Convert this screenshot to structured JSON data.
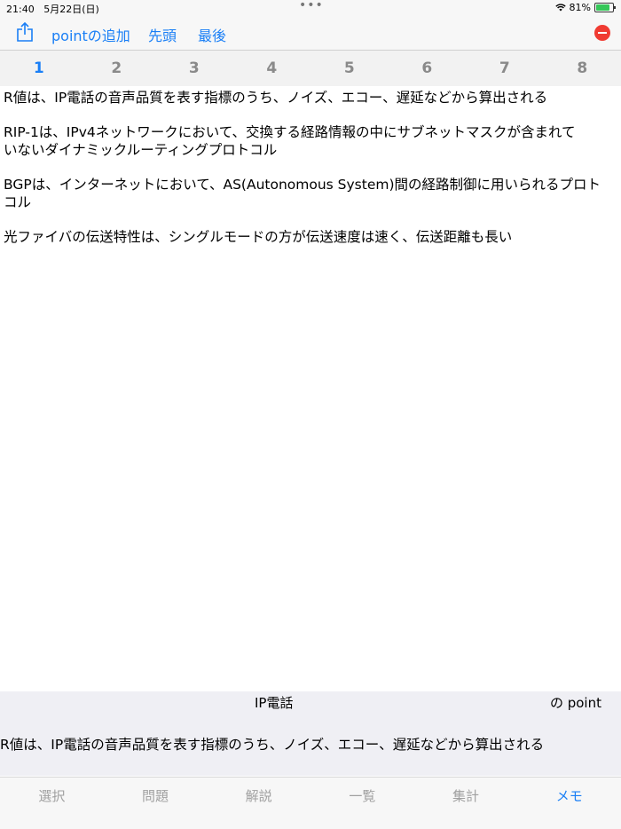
{
  "status": {
    "time": "21:40",
    "date": "5月22日(日)",
    "battery": "81%",
    "battery_level": 0.81
  },
  "toolbar": {
    "add_point": "pointの追加",
    "first": "先頭",
    "last": "最後"
  },
  "tabs": [
    "1",
    "2",
    "3",
    "4",
    "5",
    "6",
    "7",
    "8"
  ],
  "content": {
    "paragraphs": [
      "R値は、IP電話の音声品質を表す指標のうち、ノイズ、エコー、遅延などから算出される",
      "RIP-1は、IPv4ネットワークにおいて、交換する経路情報の中にサブネットマスクが含まれて\nいないダイナミックルーティングプロトコル",
      "BGPは、インターネットにおいて、AS(Autonomous System)間の経路制御に用いられるプロト\nコル",
      "光ファイバの伝送特性は、シングルモードの方が伝送速度は速く、伝送距離も長い"
    ]
  },
  "point": {
    "title": "IP電話",
    "suffix": "の point",
    "text": "R値は、IP電話の音声品質を表す指標のうち、ノイズ、エコー、遅延などから算出される"
  },
  "bottom_tabs": [
    "選択",
    "問題",
    "解説",
    "一覧",
    "集計",
    "メモ"
  ],
  "colors": {
    "accent": "#1a7ff6",
    "delete": "#f03b32"
  }
}
